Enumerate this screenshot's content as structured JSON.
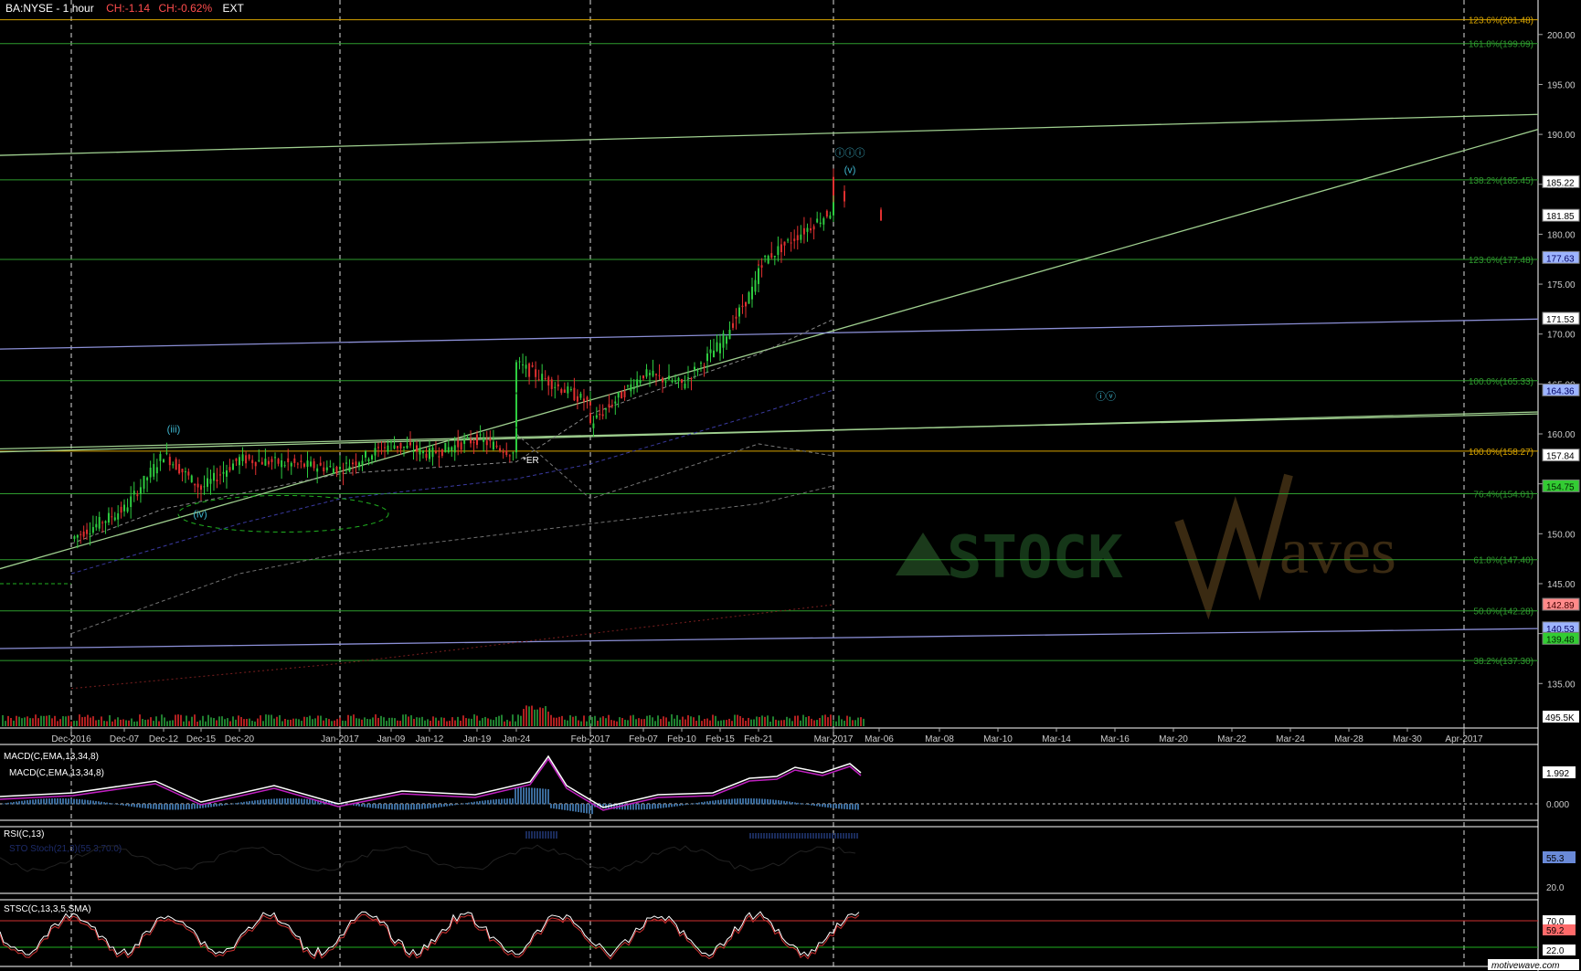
{
  "header": {
    "symbol": "BA:NYSE - 1 hour",
    "change": "CH:-1.14",
    "change_pct": "CH:-0.62%",
    "session": "EXT"
  },
  "colors": {
    "background": "#000000",
    "fib_green": "#2e9c2e",
    "fib_yellow": "#d8a400",
    "channel_blue": "#8b8fd6",
    "channel_green": "#9fcf8f",
    "up_candle": "#2ecc40",
    "down_candle": "#e03030",
    "wave_label": "#3fb7d0",
    "macd_line": "#ffffff",
    "macd_signal": "#c020c0",
    "rsi_ob": "#d03030",
    "rsi_os": "#20b020",
    "watermark": "#3a2a12"
  },
  "chart_data": [
    {
      "type": "line",
      "panel": "price",
      "yscale": "linear",
      "ylim": [
        131,
        203
      ],
      "x_ticks": [
        "Dec-2016",
        "Dec-07",
        "Dec-12",
        "Dec-15",
        "Dec-20",
        "Jan-2017",
        "Jan-09",
        "Jan-12",
        "Jan-19",
        "Jan-24",
        "Feb-2017",
        "Feb-07",
        "Feb-10",
        "Feb-15",
        "Feb-21",
        "Mar-2017",
        "Mar-06",
        "Mar-08",
        "Mar-10",
        "Mar-14",
        "Mar-16",
        "Mar-20",
        "Mar-22",
        "Mar-24",
        "Mar-28",
        "Mar-30",
        "Apr-2017"
      ],
      "y_ticks": [
        135,
        140,
        145,
        150,
        155,
        160,
        165,
        170,
        175,
        180,
        185,
        190,
        195,
        200
      ],
      "price_path": [
        [
          "Dec-2016",
          149.5
        ],
        [
          "Dec-07",
          152.5
        ],
        [
          "Dec-12",
          158.0
        ],
        [
          "Dec-15",
          154.5
        ],
        [
          "Dec-20",
          157.5
        ],
        [
          "Jan-2017",
          156.5
        ],
        [
          "Jan-09",
          159.0
        ],
        [
          "Jan-12",
          158.0
        ],
        [
          "Jan-19",
          159.5
        ],
        [
          "Jan-24",
          158.0
        ],
        [
          "Jan-24",
          167.0
        ],
        [
          "Feb-2017",
          163.0
        ],
        [
          "Feb-2017",
          161.0
        ],
        [
          "Feb-07",
          166.0
        ],
        [
          "Feb-10",
          165.0
        ],
        [
          "Feb-15",
          169.0
        ],
        [
          "Feb-21",
          175.5
        ],
        [
          "Feb-21",
          177.0
        ],
        [
          "Mar-2017",
          182.5
        ],
        [
          "Mar-2017",
          185.2
        ],
        [
          "Mar-2017",
          181.85
        ]
      ],
      "fib_levels": [
        {
          "label": "123.6%(201.48)",
          "value": 201.48,
          "color": "yellow"
        },
        {
          "label": "161.8%(199.09)",
          "value": 199.09,
          "color": "green"
        },
        {
          "label": "138.2%(185.45)",
          "value": 185.45,
          "color": "green"
        },
        {
          "label": "123.6%(177.48)",
          "value": 177.48,
          "color": "green"
        },
        {
          "label": "100.0%(165.33)",
          "value": 165.33,
          "color": "green"
        },
        {
          "label": "100.0%(158.27)",
          "value": 158.27,
          "color": "yellow"
        },
        {
          "label": "76.4%(154.01)",
          "value": 154.01,
          "color": "green"
        },
        {
          "label": "61.8%(147.40)",
          "value": 147.4,
          "color": "green"
        },
        {
          "label": "50.0%(142.28)",
          "value": 142.28,
          "color": "green"
        },
        {
          "label": "38.2%(137.30)",
          "value": 137.3,
          "color": "green"
        }
      ],
      "price_badges": [
        {
          "label": "185.22",
          "value": 185.22,
          "style": "white"
        },
        {
          "label": "181.85",
          "value": 181.85,
          "style": "white"
        },
        {
          "label": "177.63",
          "value": 177.63,
          "style": "blue"
        },
        {
          "label": "171.53",
          "value": 171.53,
          "style": "white"
        },
        {
          "label": "164.36",
          "value": 164.36,
          "style": "blue"
        },
        {
          "label": "157.84",
          "value": 157.84,
          "style": "white"
        },
        {
          "label": "154.75",
          "value": 154.75,
          "style": "green"
        },
        {
          "label": "142.89",
          "value": 142.89,
          "style": "red"
        },
        {
          "label": "140.53",
          "value": 140.53,
          "style": "blue"
        },
        {
          "label": "139.48",
          "value": 139.48,
          "style": "green"
        }
      ],
      "wave_labels": [
        {
          "label": "(iii)",
          "x": "Dec-12",
          "y": 160.5
        },
        {
          "label": "(iv)",
          "x": "Dec-15",
          "y": 152.0
        },
        {
          "label": "ⓘⓘⓘ",
          "x": "Mar-2017",
          "y": 188.2
        },
        {
          "label": "(v)",
          "x": "Mar-2017",
          "y": 186.5
        },
        {
          "label": "ⓘⓥ",
          "x": "Mar-16",
          "y": 163.8
        }
      ],
      "annotations": [
        {
          "label": "*ER",
          "x": "Jan-24",
          "y": 158.0
        }
      ],
      "volume_badge": "495.5K",
      "watermark": {
        "prefix": "STOCK",
        "suffix": "aves",
        "initial": "W"
      }
    },
    {
      "type": "line",
      "panel": "macd",
      "title": "MACD(C,EMA,13,34,8)",
      "legend": [
        "MACD(C,EMA,13,34,8)"
      ],
      "badges": [
        "1.992",
        "0.000"
      ]
    },
    {
      "type": "line",
      "panel": "rsi",
      "title": "RSI(C,13)",
      "overlay": "STO Stoch(21,3)(55.3,70.0)",
      "badges": [
        "55.3",
        "20.0"
      ]
    },
    {
      "type": "line",
      "panel": "sto",
      "title": "STSC(C,13,3,5,SMA)",
      "badges": [
        "70.0",
        "59.2",
        "22.0"
      ],
      "footer": "motivewave.com"
    }
  ]
}
